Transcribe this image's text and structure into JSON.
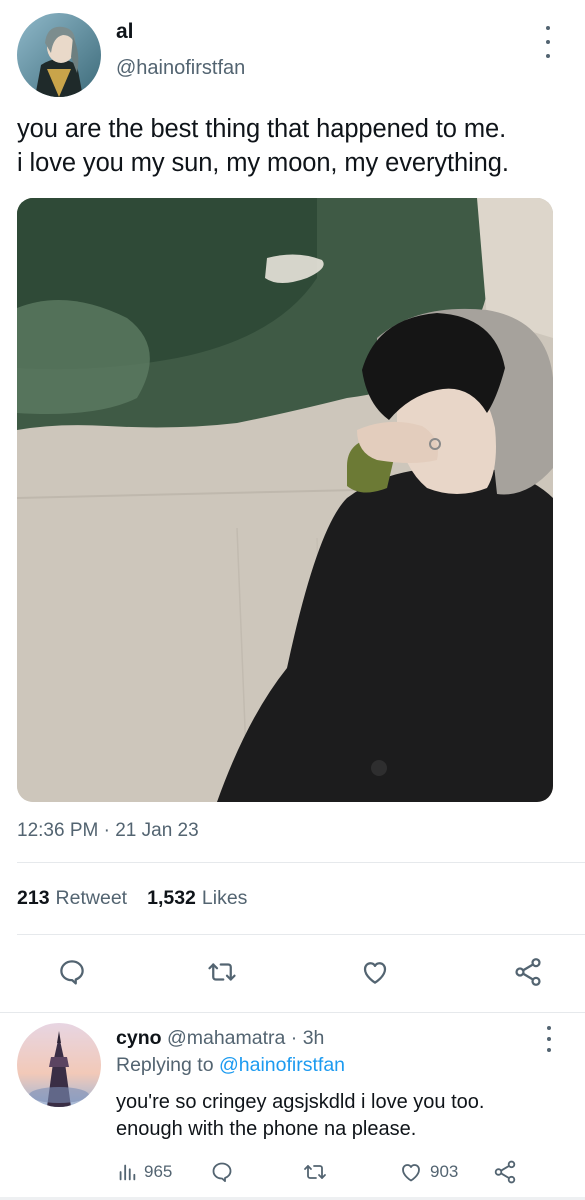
{
  "tweet": {
    "display_name": "al",
    "handle": "@hainofirstfan",
    "text": "you are the best thing that happened to me.\ni love you my sun, my moon, my everything.",
    "timestamp": "12:36 PM · 21 Jan 23",
    "retweet_count": "213",
    "retweet_label": "Retweet",
    "like_count": "1,532",
    "like_label": "Likes"
  },
  "actions": {
    "icons": [
      "reply-icon",
      "retweet-icon",
      "like-icon",
      "share-icon"
    ]
  },
  "reply": {
    "display_name": "cyno",
    "handle": "@mahamatra",
    "separator": "·",
    "time": "3h",
    "replying_prefix": "Replying to",
    "replying_to": "@hainofirstfan",
    "text": "you're so cringey agsjskdld i love you too.\nenough with the phone na please.",
    "views": "965",
    "likes": "903"
  },
  "colors": {
    "text": "#0f1419",
    "secondary": "#536471",
    "accent": "#1d9bf0",
    "divider": "#e6e9ec"
  }
}
